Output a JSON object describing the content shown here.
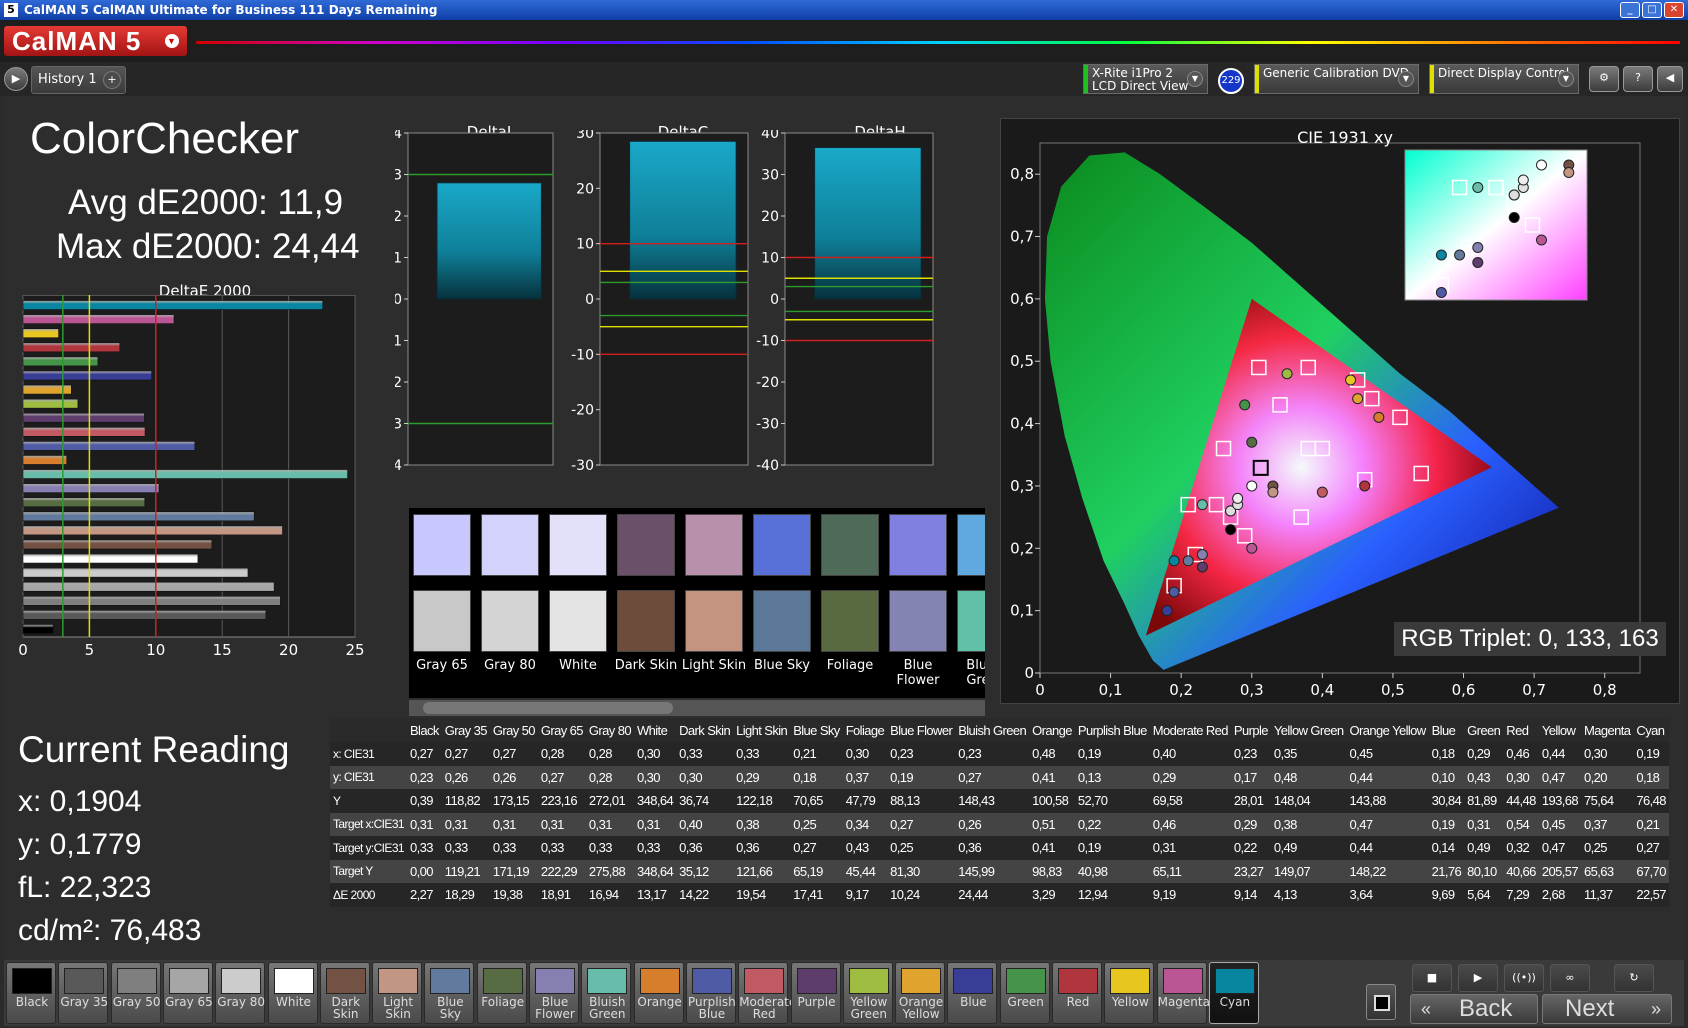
{
  "window": {
    "title": "CalMAN 5 CalMAN Ultimate for Business 111 Days Remaining",
    "app_icon": "5"
  },
  "brand": {
    "name": "CalMAN 5"
  },
  "tabs": {
    "history": "History 1"
  },
  "devices": {
    "meter_line1": "X-Rite i1Pro 2",
    "meter_line2": "LCD Direct View",
    "source": "Generic Calibration DVD",
    "display": "Direct Display Control",
    "badge": "229"
  },
  "summary": {
    "title": "ColorChecker",
    "avg": "Avg dE2000: 11,9",
    "max": "Max dE2000: 24,44"
  },
  "charts_titles": {
    "deltae": "DeltaE 2000",
    "deltal": "DeltaL",
    "deltac": "DeltaC",
    "deltah": "DeltaH",
    "cie": "CIE 1931 xy"
  },
  "rgb_triplet": "RGB Triplet: 0, 133, 163",
  "current_reading": {
    "title": "Current Reading",
    "x": "x: 0,1904",
    "y": "y: 0,1779",
    "fl": "fL: 22,323",
    "cdm2": "cd/m²: 76,483"
  },
  "patch_strip": [
    {
      "top": "#c8c8ff",
      "bottom": "#c8c8c8",
      "label": "Gray 65"
    },
    {
      "top": "#d2d2fa",
      "bottom": "#d4d4d4",
      "label": "Gray 80"
    },
    {
      "top": "#e3e0fa",
      "bottom": "#e4e4e4",
      "label": "White"
    },
    {
      "top": "#6a5068",
      "bottom": "#6e4c3c",
      "label": "Dark Skin"
    },
    {
      "top": "#b890ac",
      "bottom": "#c49480",
      "label": "Light Skin"
    },
    {
      "top": "#5870d8",
      "bottom": "#5c7898",
      "label": "Blue Sky"
    },
    {
      "top": "#4e6a58",
      "bottom": "#5a6a40",
      "label": "Foliage"
    },
    {
      "top": "#8080e0",
      "bottom": "#8484b4",
      "label": "Blue Flower"
    },
    {
      "top": "#60a8e0",
      "bottom": "#60c0a8",
      "label": "Bluish Green"
    }
  ],
  "table": {
    "columns": [
      "Black",
      "Gray 35",
      "Gray 50",
      "Gray 65",
      "Gray 80",
      "White",
      "Dark Skin",
      "Light Skin",
      "Blue Sky",
      "Foliage",
      "Blue Flower",
      "Bluish Green",
      "Orange",
      "Purplish Blue",
      "Moderate Red",
      "Purple",
      "Yellow Green",
      "Orange Yellow",
      "Blue",
      "Green",
      "Red",
      "Yellow",
      "Magenta",
      "Cyan"
    ],
    "rows": [
      {
        "label": "x: CIE31",
        "values": [
          "0,27",
          "0,27",
          "0,27",
          "0,28",
          "0,28",
          "0,30",
          "0,33",
          "0,33",
          "0,21",
          "0,30",
          "0,23",
          "0,23",
          "0,48",
          "0,19",
          "0,40",
          "0,23",
          "0,35",
          "0,45",
          "0,18",
          "0,29",
          "0,46",
          "0,44",
          "0,30",
          "0,19"
        ]
      },
      {
        "label": "y: CIE31",
        "values": [
          "0,23",
          "0,26",
          "0,26",
          "0,27",
          "0,28",
          "0,30",
          "0,30",
          "0,29",
          "0,18",
          "0,37",
          "0,19",
          "0,27",
          "0,41",
          "0,13",
          "0,29",
          "0,17",
          "0,48",
          "0,44",
          "0,10",
          "0,43",
          "0,30",
          "0,47",
          "0,20",
          "0,18"
        ]
      },
      {
        "label": "Y",
        "values": [
          "0,39",
          "118,82",
          "173,15",
          "223,16",
          "272,01",
          "348,64",
          "36,74",
          "122,18",
          "70,65",
          "47,79",
          "88,13",
          "148,43",
          "100,58",
          "52,70",
          "69,58",
          "28,01",
          "148,04",
          "143,88",
          "30,84",
          "81,89",
          "44,48",
          "193,68",
          "75,64",
          "76,48"
        ]
      },
      {
        "label": "Target x:CIE31",
        "values": [
          "0,31",
          "0,31",
          "0,31",
          "0,31",
          "0,31",
          "0,31",
          "0,40",
          "0,38",
          "0,25",
          "0,34",
          "0,27",
          "0,26",
          "0,51",
          "0,22",
          "0,46",
          "0,29",
          "0,38",
          "0,47",
          "0,19",
          "0,31",
          "0,54",
          "0,45",
          "0,37",
          "0,21"
        ]
      },
      {
        "label": "Target y:CIE31",
        "values": [
          "0,33",
          "0,33",
          "0,33",
          "0,33",
          "0,33",
          "0,33",
          "0,36",
          "0,36",
          "0,27",
          "0,43",
          "0,25",
          "0,36",
          "0,41",
          "0,19",
          "0,31",
          "0,22",
          "0,49",
          "0,44",
          "0,14",
          "0,49",
          "0,32",
          "0,47",
          "0,25",
          "0,27"
        ]
      },
      {
        "label": "Target Y",
        "values": [
          "0,00",
          "119,21",
          "171,19",
          "222,29",
          "275,88",
          "348,64",
          "35,12",
          "121,66",
          "65,19",
          "45,44",
          "81,30",
          "145,99",
          "98,83",
          "40,98",
          "65,11",
          "23,27",
          "149,07",
          "148,22",
          "21,76",
          "80,10",
          "40,66",
          "205,57",
          "65,63",
          "67,70"
        ]
      },
      {
        "label": "ΔE 2000",
        "values": [
          "2,27",
          "18,29",
          "19,38",
          "18,91",
          "16,94",
          "13,17",
          "14,22",
          "19,54",
          "17,41",
          "9,17",
          "10,24",
          "24,44",
          "3,29",
          "12,94",
          "9,19",
          "9,14",
          "4,13",
          "3,64",
          "9,69",
          "5,64",
          "7,29",
          "2,68",
          "11,37",
          "22,57"
        ]
      }
    ]
  },
  "swatches": [
    {
      "label": "Black",
      "color": "#000000"
    },
    {
      "label": "Gray 35",
      "color": "#595959"
    },
    {
      "label": "Gray 50",
      "color": "#7f7f7f"
    },
    {
      "label": "Gray 65",
      "color": "#a6a6a6"
    },
    {
      "label": "Gray 80",
      "color": "#cccccc"
    },
    {
      "label": "White",
      "color": "#ffffff"
    },
    {
      "label": "Dark Skin",
      "color": "#735244"
    },
    {
      "label": "Light Skin",
      "color": "#c29682"
    },
    {
      "label": "Blue Sky",
      "color": "#627a9d"
    },
    {
      "label": "Foliage",
      "color": "#576c43"
    },
    {
      "label": "Blue Flower",
      "color": "#8580b1"
    },
    {
      "label": "Bluish Green",
      "color": "#67bdaa"
    },
    {
      "label": "Orange",
      "color": "#d67e2c"
    },
    {
      "label": "Purplish Blue",
      "color": "#505ba6"
    },
    {
      "label": "Moderate Red",
      "color": "#c15a63"
    },
    {
      "label": "Purple",
      "color": "#5e3c6c"
    },
    {
      "label": "Yellow Green",
      "color": "#9dbc40"
    },
    {
      "label": "Orange Yellow",
      "color": "#e0a32e"
    },
    {
      "label": "Blue",
      "color": "#383d96"
    },
    {
      "label": "Green",
      "color": "#469449"
    },
    {
      "label": "Red",
      "color": "#af363c"
    },
    {
      "label": "Yellow",
      "color": "#e7c71f"
    },
    {
      "label": "Magenta",
      "color": "#bb5695"
    },
    {
      "label": "Cyan",
      "color": "#0885a1"
    }
  ],
  "nav": {
    "back": "Back",
    "next": "Next"
  },
  "chart_data": [
    {
      "type": "bar",
      "title": "DeltaE 2000",
      "orientation": "horizontal",
      "xlim": [
        0,
        25
      ],
      "ticks": [
        0,
        5,
        10,
        15,
        20,
        25
      ],
      "reference_lines": [
        {
          "value": 3,
          "color": "#2e9b2e"
        },
        {
          "value": 5,
          "color": "#e0e000"
        },
        {
          "value": 10,
          "color": "#d02020"
        }
      ],
      "categories": [
        "Cyan",
        "Magenta",
        "Yellow",
        "Red",
        "Green",
        "Blue",
        "Orange Yellow",
        "Yellow Green",
        "Purple",
        "Moderate Red",
        "Purplish Blue",
        "Orange",
        "Bluish Green",
        "Blue Flower",
        "Foliage",
        "Blue Sky",
        "Light Skin",
        "Dark Skin",
        "White",
        "Gray 80",
        "Gray 65",
        "Gray 50",
        "Gray 35",
        "Black"
      ],
      "values": [
        22.57,
        11.37,
        2.68,
        7.29,
        5.64,
        9.69,
        3.64,
        4.13,
        9.14,
        9.19,
        12.94,
        3.29,
        24.44,
        10.24,
        9.17,
        17.41,
        19.54,
        14.22,
        13.17,
        16.94,
        18.91,
        19.38,
        18.29,
        2.27
      ],
      "colors": [
        "#0885a1",
        "#bb5695",
        "#e7c71f",
        "#af363c",
        "#469449",
        "#383d96",
        "#e0a32e",
        "#9dbc40",
        "#5e3c6c",
        "#c15a63",
        "#505ba6",
        "#d67e2c",
        "#67bdaa",
        "#8580b1",
        "#576c43",
        "#627a9d",
        "#c29682",
        "#735244",
        "#ffffff",
        "#cccccc",
        "#a6a6a6",
        "#7f7f7f",
        "#595959",
        "#000000"
      ]
    },
    {
      "type": "bar",
      "title": "DeltaL",
      "ylim": [
        -4,
        4
      ],
      "ticks": [
        4,
        3,
        2,
        1,
        0,
        -1,
        -2,
        -3,
        -4
      ],
      "value": 2.8,
      "reference_lines": [
        {
          "value": 3,
          "color": "#2e9b2e"
        },
        {
          "value": -3,
          "color": "#2e9b2e"
        }
      ]
    },
    {
      "type": "bar",
      "title": "DeltaC",
      "ylim": [
        -30,
        30
      ],
      "ticks": [
        30,
        20,
        10,
        0,
        -10,
        -20,
        -30
      ],
      "value": 28.5,
      "reference_lines": [
        {
          "value": 10,
          "color": "#d02020"
        },
        {
          "value": 5,
          "color": "#e0e000"
        },
        {
          "value": 3,
          "color": "#2e9b2e"
        },
        {
          "value": -3,
          "color": "#2e9b2e"
        },
        {
          "value": -5,
          "color": "#e0e000"
        },
        {
          "value": -10,
          "color": "#d02020"
        }
      ]
    },
    {
      "type": "bar",
      "title": "DeltaH",
      "ylim": [
        -40,
        40
      ],
      "ticks": [
        40,
        30,
        20,
        10,
        0,
        -10,
        -20,
        -30,
        -40
      ],
      "value": 36.5,
      "reference_lines": [
        {
          "value": 10,
          "color": "#d02020"
        },
        {
          "value": 5,
          "color": "#e0e000"
        },
        {
          "value": 3,
          "color": "#2e9b2e"
        },
        {
          "value": -3,
          "color": "#2e9b2e"
        },
        {
          "value": -5,
          "color": "#e0e000"
        },
        {
          "value": -10,
          "color": "#d02020"
        }
      ]
    },
    {
      "type": "scatter",
      "title": "CIE 1931 xy",
      "xlim": [
        0,
        0.85
      ],
      "ylim": [
        0,
        0.85
      ],
      "xticks": [
        "0",
        "0,1",
        "0,2",
        "0,3",
        "0,4",
        "0,5",
        "0,6",
        "0,7",
        "0,8"
      ],
      "yticks": [
        "0",
        "0,1",
        "0,2",
        "0,3",
        "0,4",
        "0,5",
        "0,6",
        "0,7",
        "0,8"
      ],
      "gamut_triangle": [
        [
          0.64,
          0.33
        ],
        [
          0.3,
          0.6
        ],
        [
          0.15,
          0.06
        ]
      ],
      "white_target": [
        0.3127,
        0.329
      ],
      "targets": [
        [
          0.4,
          0.36
        ],
        [
          0.38,
          0.36
        ],
        [
          0.25,
          0.27
        ],
        [
          0.34,
          0.43
        ],
        [
          0.27,
          0.25
        ],
        [
          0.26,
          0.36
        ],
        [
          0.51,
          0.41
        ],
        [
          0.22,
          0.19
        ],
        [
          0.46,
          0.31
        ],
        [
          0.29,
          0.22
        ],
        [
          0.38,
          0.49
        ],
        [
          0.47,
          0.44
        ],
        [
          0.19,
          0.14
        ],
        [
          0.31,
          0.49
        ],
        [
          0.54,
          0.32
        ],
        [
          0.45,
          0.47
        ],
        [
          0.37,
          0.25
        ],
        [
          0.21,
          0.27
        ]
      ],
      "measured": [
        {
          "x": 0.27,
          "y": 0.23,
          "color": "#000000"
        },
        {
          "x": 0.27,
          "y": 0.26,
          "color": "#dddddd"
        },
        {
          "x": 0.27,
          "y": 0.26,
          "color": "#dddddd"
        },
        {
          "x": 0.28,
          "y": 0.27,
          "color": "#e0e0e0"
        },
        {
          "x": 0.28,
          "y": 0.28,
          "color": "#eeeeee"
        },
        {
          "x": 0.3,
          "y": 0.3,
          "color": "#ffffff"
        },
        {
          "x": 0.33,
          "y": 0.3,
          "color": "#735244"
        },
        {
          "x": 0.33,
          "y": 0.29,
          "color": "#c29682"
        },
        {
          "x": 0.21,
          "y": 0.18,
          "color": "#627a9d"
        },
        {
          "x": 0.3,
          "y": 0.37,
          "color": "#576c43"
        },
        {
          "x": 0.23,
          "y": 0.19,
          "color": "#8580b1"
        },
        {
          "x": 0.23,
          "y": 0.27,
          "color": "#67bdaa"
        },
        {
          "x": 0.48,
          "y": 0.41,
          "color": "#d67e2c"
        },
        {
          "x": 0.19,
          "y": 0.13,
          "color": "#505ba6"
        },
        {
          "x": 0.4,
          "y": 0.29,
          "color": "#c15a63"
        },
        {
          "x": 0.23,
          "y": 0.17,
          "color": "#5e3c6c"
        },
        {
          "x": 0.35,
          "y": 0.48,
          "color": "#9dbc40"
        },
        {
          "x": 0.45,
          "y": 0.44,
          "color": "#e0a32e"
        },
        {
          "x": 0.18,
          "y": 0.1,
          "color": "#383d96"
        },
        {
          "x": 0.29,
          "y": 0.43,
          "color": "#469449"
        },
        {
          "x": 0.46,
          "y": 0.3,
          "color": "#af363c"
        },
        {
          "x": 0.44,
          "y": 0.47,
          "color": "#e7c71f"
        },
        {
          "x": 0.3,
          "y": 0.2,
          "color": "#bb5695"
        },
        {
          "x": 0.19,
          "y": 0.18,
          "color": "#0885a1"
        }
      ]
    }
  ]
}
